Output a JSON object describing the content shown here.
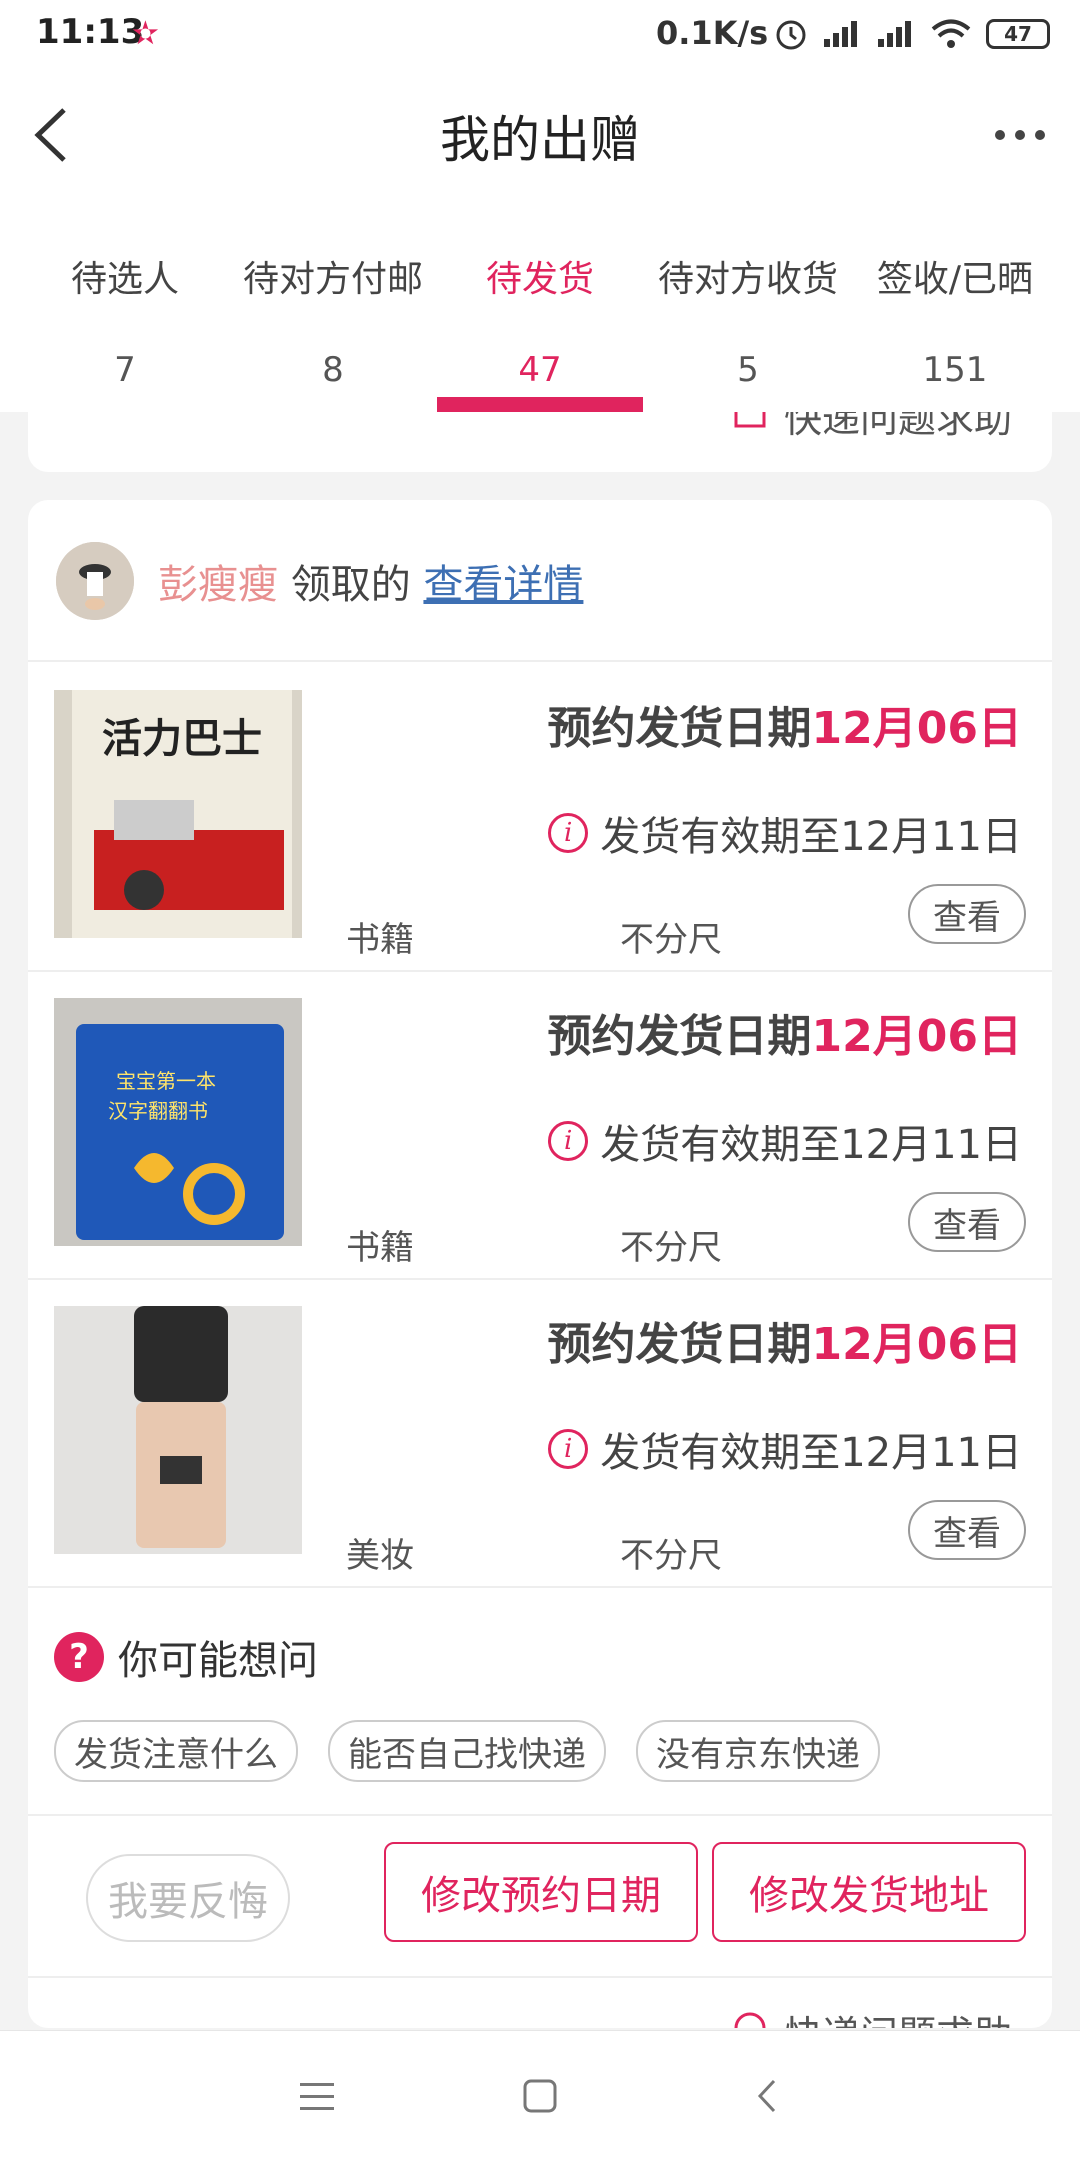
{
  "status_bar": {
    "time": "11:13",
    "net_speed": "0.1K/s",
    "battery": "47"
  },
  "nav": {
    "title": "我的出赠"
  },
  "tabs": [
    {
      "label": "待选人",
      "count": "7"
    },
    {
      "label": "待对方付邮",
      "count": "8"
    },
    {
      "label": "待发货",
      "count": "47"
    },
    {
      "label": "待对方收货",
      "count": "5"
    },
    {
      "label": "签收/已晒",
      "count": "151"
    }
  ],
  "help_link": "快递问题求助",
  "giver": {
    "name": "彭瘦瘦",
    "mid": "领取的",
    "link": "查看详情"
  },
  "items": [
    {
      "appt_label": "预约发货日期",
      "appt_date": "12月06日",
      "validity": "发货有效期至12月11日",
      "category": "书籍",
      "size": "不分尺",
      "view": "查看"
    },
    {
      "appt_label": "预约发货日期",
      "appt_date": "12月06日",
      "validity": "发货有效期至12月11日",
      "category": "书籍",
      "size": "不分尺",
      "view": "查看"
    },
    {
      "appt_label": "预约发货日期",
      "appt_date": "12月06日",
      "validity": "发货有效期至12月11日",
      "category": "美妆",
      "size": "不分尺",
      "view": "查看"
    }
  ],
  "faq": {
    "title": "你可能想问",
    "chips": [
      "发货注意什么",
      "能否自己找快递",
      "没有京东快递"
    ]
  },
  "actions": {
    "regret": "我要反悔",
    "modify_date": "修改预约日期",
    "modify_address": "修改发货地址"
  },
  "colors": {
    "accent": "#e0245e",
    "link": "#3d6fb3"
  }
}
